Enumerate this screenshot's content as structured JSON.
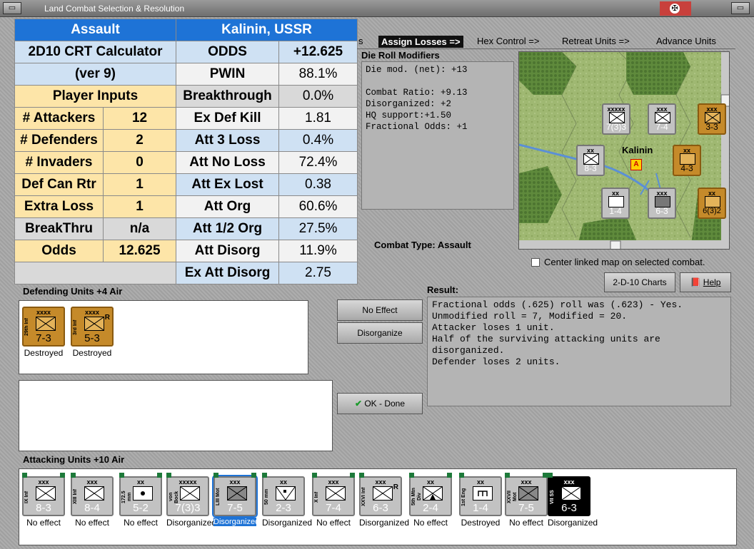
{
  "window": {
    "title": "Land Combat Selection & Resolution"
  },
  "crt": {
    "header_left": "Assault",
    "header_right": "Kalinin, USSR",
    "calc_title": "2D10 CRT Calculator",
    "calc_version": "(ver 9)",
    "player_inputs": "Player Inputs",
    "inputs": [
      {
        "label": "# Attackers",
        "value": "12"
      },
      {
        "label": "# Defenders",
        "value": "2"
      },
      {
        "label": "# Invaders",
        "value": "0"
      },
      {
        "label": "Def Can Rtr",
        "value": "1"
      },
      {
        "label": "Extra Loss",
        "value": "1"
      },
      {
        "label": "BreakThru",
        "value": "n/a"
      },
      {
        "label": "Odds",
        "value": "12.625"
      }
    ],
    "results": [
      {
        "label": "ODDS",
        "value": "+12.625"
      },
      {
        "label": "PWIN",
        "value": "88.1%"
      },
      {
        "label": "Breakthrough",
        "value": "0.0%"
      },
      {
        "label": "Ex Def Kill",
        "value": "1.81"
      },
      {
        "label": "Att 3 Loss",
        "value": "0.4%"
      },
      {
        "label": "Att No Loss",
        "value": "72.4%"
      },
      {
        "label": "Att Ex Lost",
        "value": "0.38"
      },
      {
        "label": "Att Org",
        "value": "60.6%"
      },
      {
        "label": "Att 1/2 Org",
        "value": "27.5%"
      },
      {
        "label": "Att Disorg",
        "value": "11.9%"
      },
      {
        "label": "Ex Att Disorg",
        "value": "2.75"
      }
    ]
  },
  "tabs": {
    "partial": "s",
    "assign": "Assign Losses =>",
    "hex": "Hex Control =>",
    "retreat": "Retreat Units =>",
    "advance": "Advance Units"
  },
  "modifiers": {
    "label": "Die Roll Modifiers",
    "lines": [
      "Die mod. (net): +13",
      "",
      "Combat Ratio: +9.13",
      "Disorganized: +2",
      "HQ support:+1.50",
      "Fractional Odds: +1"
    ]
  },
  "combat_type": "Combat Type:  Assault",
  "map": {
    "city": "Kalinin",
    "city_partial": "nin",
    "counters": [
      {
        "size": "xxxxx",
        "str": "7(3)3"
      },
      {
        "size": "xxx",
        "str": "7-4"
      },
      {
        "size": "xxx",
        "str": "3-3"
      },
      {
        "size": "xx",
        "str": "8-3"
      },
      {
        "size": "xx",
        "str": "4-3"
      },
      {
        "size": "xx",
        "str": "1-4"
      },
      {
        "size": "xxx",
        "str": "6-3"
      },
      {
        "size": "xx",
        "str": "6(3)2"
      }
    ]
  },
  "center_map": "Center linked map on selected combat.",
  "buttons": {
    "charts": "2-D-10 Charts",
    "help": "Help",
    "no_effect": "No Effect",
    "disorganize": "Disorganize",
    "ok": "OK - Done"
  },
  "defending": {
    "label": "Defending Units +4 Air",
    "units": [
      {
        "name": "29th Inf",
        "size": "xxxx",
        "str": "7-3",
        "status": "Destroyed",
        "flag": ""
      },
      {
        "name": "3rd Inf",
        "size": "xxxx",
        "str": "5-3",
        "status": "Destroyed",
        "flag": "R"
      }
    ]
  },
  "result": {
    "label": "Result:",
    "lines": [
      "Fractional odds (.625) roll was (.623)  - Yes.",
      "Unmodified roll = 7, Modified = 20.",
      "Attacker loses 1 unit.",
      "Half of the surviving attacking units are disorganized.",
      "Defender loses 2 units."
    ]
  },
  "attacking": {
    "label": "Attacking Units +10 Air",
    "units": [
      {
        "name": "IX Inf",
        "size": "xxx",
        "str": "8-3",
        "status": "No effect",
        "kind": "inf"
      },
      {
        "name": "XIII Inf",
        "size": "xxx",
        "str": "8-4",
        "status": "No effect",
        "kind": "inf"
      },
      {
        "name": "172.5 mm",
        "size": "xx",
        "str": "5-2",
        "status": "No effect",
        "kind": "art"
      },
      {
        "name": "von Bock",
        "size": "xxxxx",
        "str": "7(3)3",
        "status": "Disorganized",
        "kind": "inf"
      },
      {
        "name": "LIII Mot",
        "size": "xxx",
        "str": "7-5",
        "status": "Disorganized",
        "kind": "mot"
      },
      {
        "name": "50 mm",
        "size": "xx",
        "str": "2-3",
        "status": "Disorganized",
        "kind": "at"
      },
      {
        "name": "X Inf",
        "size": "xxx",
        "str": "7-4",
        "status": "No effect",
        "kind": "inf"
      },
      {
        "name": "XXVI Inf",
        "size": "xxx",
        "str": "6-3",
        "status": "Disorganized",
        "kind": "inf"
      },
      {
        "name": "5th Mtn Div",
        "size": "xx",
        "str": "2-4",
        "status": "No effect",
        "kind": "mtn"
      },
      {
        "name": "1st Eng",
        "size": "xx",
        "str": "1-4",
        "status": "Destroyed",
        "kind": "eng"
      },
      {
        "name": "XXVII Mot",
        "size": "xxx",
        "str": "7-5",
        "status": "No effect",
        "kind": "mot"
      },
      {
        "name": "VII SS",
        "size": "xxx",
        "str": "6-3",
        "status": "Disorganized",
        "kind": "inf"
      }
    ]
  }
}
